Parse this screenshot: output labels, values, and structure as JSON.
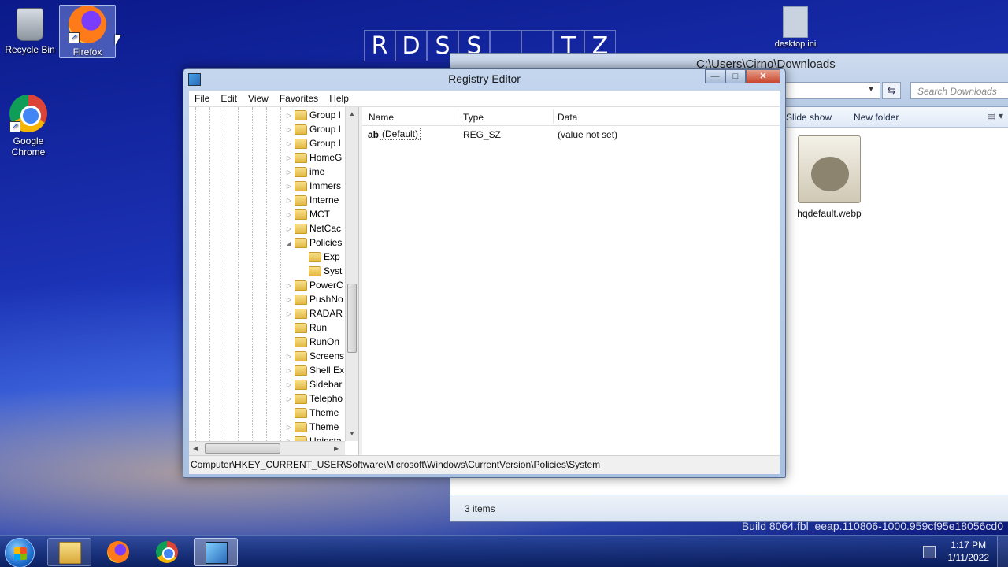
{
  "desktop": {
    "icons": [
      {
        "label": "Recycle Bin",
        "icon": "recycle-bin-icon"
      },
      {
        "label": "Firefox",
        "icon": "firefox-icon"
      },
      {
        "label": "Google Chrome",
        "icon": "chrome-icon"
      }
    ],
    "background_letters": [
      "R",
      "D",
      "S",
      "S",
      "",
      "",
      "T",
      "Z"
    ],
    "desktop_ini_label": "desktop.ini",
    "build_text": "Build 8064.fbl_eeap.110806-1000.959cf95e18056cd0"
  },
  "explorer": {
    "path_title": "C:\\Users\\Cirno\\Downloads",
    "search_placeholder": "Search Downloads",
    "commands": [
      "Slide show",
      "New folder"
    ],
    "file_name": "hqdefault.webp",
    "status": "3 items"
  },
  "regedit": {
    "title": "Registry Editor",
    "window_buttons": {
      "minimize": "—",
      "maximize": "□",
      "close": "✕"
    },
    "menu": [
      "File",
      "Edit",
      "View",
      "Favorites",
      "Help"
    ],
    "tree": [
      {
        "label": "Group I",
        "level": 0,
        "expander": "▷"
      },
      {
        "label": "Group I",
        "level": 0,
        "expander": "▷"
      },
      {
        "label": "Group I",
        "level": 0,
        "expander": "▷"
      },
      {
        "label": "HomeG",
        "level": 0,
        "expander": "▷"
      },
      {
        "label": "ime",
        "level": 0,
        "expander": "▷"
      },
      {
        "label": "Immers",
        "level": 0,
        "expander": "▷"
      },
      {
        "label": "Interne",
        "level": 0,
        "expander": "▷"
      },
      {
        "label": "MCT",
        "level": 0,
        "expander": "▷"
      },
      {
        "label": "NetCac",
        "level": 0,
        "expander": "▷"
      },
      {
        "label": "Policies",
        "level": 0,
        "expander": "◢"
      },
      {
        "label": "Exp",
        "level": 1,
        "expander": ""
      },
      {
        "label": "Syst",
        "level": 1,
        "expander": ""
      },
      {
        "label": "PowerC",
        "level": 0,
        "expander": "▷"
      },
      {
        "label": "PushNo",
        "level": 0,
        "expander": "▷"
      },
      {
        "label": "RADAR",
        "level": 0,
        "expander": "▷"
      },
      {
        "label": "Run",
        "level": 0,
        "expander": ""
      },
      {
        "label": "RunOn",
        "level": 0,
        "expander": ""
      },
      {
        "label": "Screens",
        "level": 0,
        "expander": "▷"
      },
      {
        "label": "Shell Ex",
        "level": 0,
        "expander": "▷"
      },
      {
        "label": "Sidebar",
        "level": 0,
        "expander": "▷"
      },
      {
        "label": "Telepho",
        "level": 0,
        "expander": "▷"
      },
      {
        "label": "Theme",
        "level": 0,
        "expander": ""
      },
      {
        "label": "Theme",
        "level": 0,
        "expander": "▷"
      },
      {
        "label": "Uninsta",
        "level": 0,
        "expander": "▷"
      }
    ],
    "columns": [
      "Name",
      "Type",
      "Data"
    ],
    "values": [
      {
        "name": "(Default)",
        "type": "REG_SZ",
        "data": "(value not set)",
        "icon_text": "ab"
      }
    ],
    "status_path": "Computer\\HKEY_CURRENT_USER\\Software\\Microsoft\\Windows\\CurrentVersion\\Policies\\System"
  },
  "taskbar": {
    "buttons": [
      {
        "name": "explorer",
        "icon": "folder-icon",
        "state": "pinned"
      },
      {
        "name": "firefox",
        "icon": "firefox-icon",
        "state": "pinned"
      },
      {
        "name": "chrome",
        "icon": "chrome-icon",
        "state": "pinned"
      },
      {
        "name": "regedit",
        "icon": "registry-editor-icon",
        "state": "active"
      }
    ],
    "time": "1:17 PM",
    "date": "1/11/2022"
  }
}
